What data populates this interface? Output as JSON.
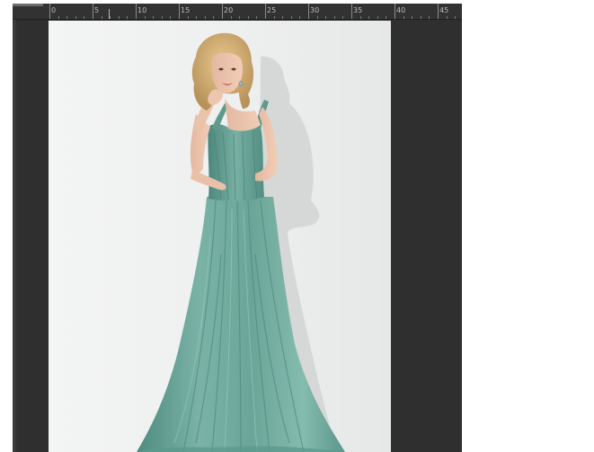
{
  "editor": {
    "ruler": {
      "labels": [
        "0",
        "5",
        "10",
        "15",
        "20",
        "25",
        "30",
        "35",
        "40",
        "45"
      ]
    }
  },
  "canvas": {
    "image_subject": "model-in-teal-chiffon-gown"
  },
  "colors": {
    "workspace": "#2f2f2f",
    "ruler": "#323232",
    "dress": "#6fa89b",
    "backdrop": "#efefef"
  }
}
